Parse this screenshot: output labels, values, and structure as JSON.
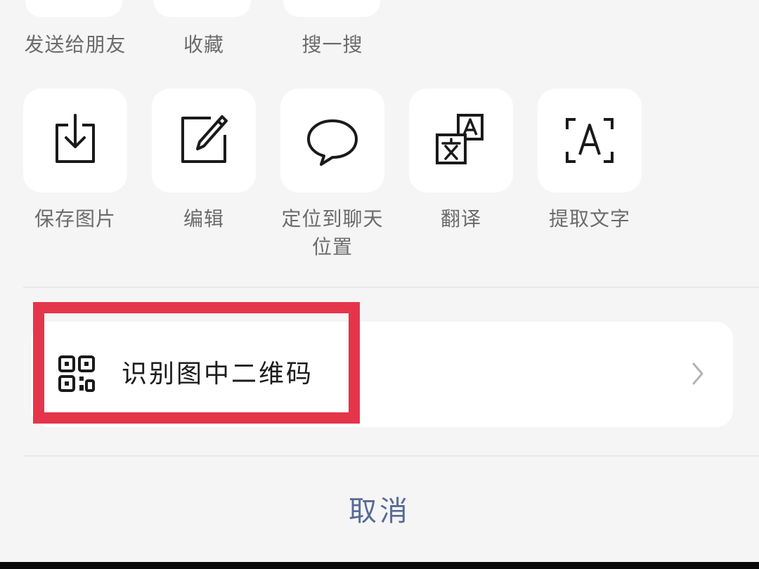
{
  "top_row": {
    "items": [
      {
        "label": "发送给朋友"
      },
      {
        "label": "收藏"
      },
      {
        "label": "搜一搜"
      }
    ]
  },
  "actions": {
    "items": [
      {
        "label": "保存图片",
        "icon": "save-image-icon"
      },
      {
        "label": "编辑",
        "icon": "edit-icon"
      },
      {
        "label_line1": "定位到聊天",
        "label_line2": "位置",
        "icon": "chat-bubble-icon"
      },
      {
        "label": "翻译",
        "icon": "translate-icon"
      },
      {
        "label": "提取文字",
        "icon": "extract-text-icon"
      }
    ]
  },
  "qr": {
    "label": "识别图中二维码",
    "icon": "qr-code-icon",
    "chevron": "chevron-right-icon"
  },
  "highlight_color": "#e5354b",
  "cancel_label": "取消",
  "colors": {
    "background": "#f5f5f5",
    "tile": "#ffffff",
    "label": "#6b6b6b",
    "link": "#576b95"
  }
}
